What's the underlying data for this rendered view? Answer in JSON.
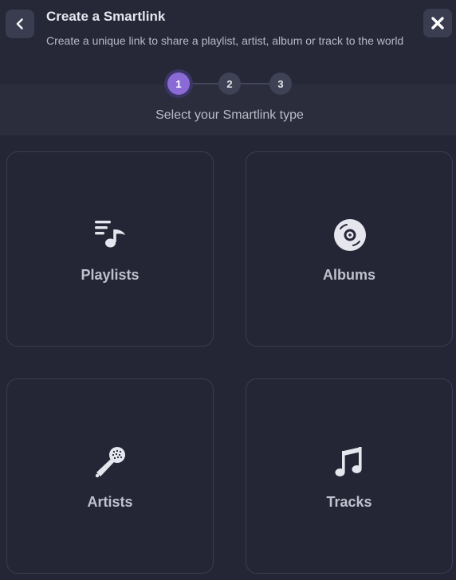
{
  "header": {
    "title": "Create a Smartlink",
    "subtitle": "Create a unique link to share a playlist, artist, album or track to the world"
  },
  "stepper": {
    "steps": [
      {
        "label": "1",
        "active": true
      },
      {
        "label": "2",
        "active": false
      },
      {
        "label": "3",
        "active": false
      }
    ],
    "caption": "Select your Smartlink type"
  },
  "types": [
    {
      "label": "Playlists",
      "icon": "playlist-icon"
    },
    {
      "label": "Albums",
      "icon": "album-disc-icon"
    },
    {
      "label": "Artists",
      "icon": "microphone-icon"
    },
    {
      "label": "Tracks",
      "icon": "music-note-icon"
    }
  ],
  "colors": {
    "background": "#242636",
    "accent": "#8a6bd6",
    "card_border": "#3b3e50",
    "icon": "#e6e7ee"
  }
}
